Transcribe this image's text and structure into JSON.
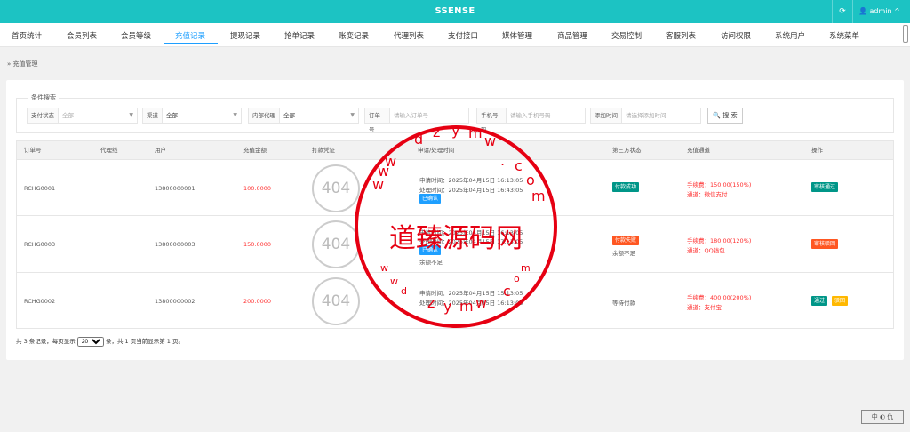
{
  "app": {
    "title": "SSENSE",
    "refresh_icon": "refresh-icon",
    "user": "admin"
  },
  "nav": [
    {
      "label": "首页统计",
      "left": 0
    },
    {
      "label": "会员列表"
    },
    {
      "label": "会员等级"
    },
    {
      "label": "充值记录",
      "active": true
    },
    {
      "label": "提现记录"
    },
    {
      "label": "抢单记录"
    },
    {
      "label": "账变记录"
    },
    {
      "label": "代理列表"
    },
    {
      "label": "支付接口"
    },
    {
      "label": "媒体管理"
    },
    {
      "label": "商品管理"
    },
    {
      "label": "交易控制"
    },
    {
      "label": "客服列表"
    },
    {
      "label": "访问权限"
    },
    {
      "label": "系统用户"
    },
    {
      "label": "系统菜单"
    }
  ],
  "breadcrumb": "充值管理",
  "search": {
    "legend": "条件搜索",
    "pay_status_label": "支付状态",
    "pay_status_value": "全部",
    "channel_label": "渠道",
    "channel_value": "全部",
    "agent_label": "内部代理",
    "agent_value": "全部",
    "order_label": "订单号",
    "order_placeholder": "请输入订单号",
    "phone_label": "手机号码",
    "phone_placeholder": "请输入手机号码",
    "time_label": "添加时间",
    "time_placeholder": "请选择添加时间",
    "button": "搜 索"
  },
  "table": {
    "headers": [
      "订单号",
      "代理线",
      "用户",
      "充值金额",
      "打款凭证",
      "申请/处理时间",
      "第三方状态",
      "充值通道",
      "操作"
    ],
    "rows": [
      {
        "order": "RCHG0001",
        "user": "13800000001",
        "amount": "100.0000",
        "proof": "404",
        "apply": "申请时间：2025年04月15日 16:13:05",
        "process": "处理时间：2025年04月15日 16:43:05",
        "status_badge": "已确认",
        "note": "",
        "third": "付款成功",
        "third_note": "",
        "fee": "手续费：150.00(150%)",
        "channel": "通道：微信支付",
        "actions": [
          "审核通过"
        ]
      },
      {
        "order": "RCHG0003",
        "user": "13800000003",
        "amount": "150.0000",
        "proof": "404",
        "apply": "申请时间：2025年04月15日 16:13:05",
        "process": "处理时间：2025年04月15日 17:13:05",
        "status_badge": "已确认",
        "note": "余额不足",
        "third": "付款失败",
        "third_note": "余额不足",
        "fee": "手续费：180.00(120%)",
        "channel": "通道：QQ钱包",
        "actions": [
          "审核驳回"
        ]
      },
      {
        "order": "RCHG0002",
        "user": "13800000002",
        "amount": "200.0000",
        "proof": "404",
        "apply": "申请时间：2025年04月15日 15:13:05",
        "process": "处理时间：2025年04月15日 16:13:05",
        "status_badge": "",
        "note": "",
        "third": "等待付款",
        "third_note": "",
        "fee": "手续费：400.00(200%)",
        "channel": "通道：支付宝",
        "actions": [
          "通过",
          "驳回"
        ]
      }
    ]
  },
  "footer": {
    "prefix": "共 3 条记录，每页显示",
    "page_size": "20",
    "suffix": "条，共 1 页当前显示第 1 页。"
  },
  "watermark": {
    "main": "道臻源码网",
    "letters": [
      "d",
      "z",
      "y",
      "m",
      "w",
      "w",
      "w",
      ".",
      "c",
      "o",
      "m",
      "w",
      "w",
      "w",
      "d",
      "z",
      "y",
      "m",
      "w",
      "c",
      "o",
      "m"
    ]
  },
  "corner_widget": "中 ◐ 仇",
  "colors": {
    "topbar": "#1cc3c3",
    "accent": "#1e9fff",
    "danger": "#ff5722",
    "success": "#009688",
    "warn": "#ffb800",
    "stamp": "#e60012"
  }
}
